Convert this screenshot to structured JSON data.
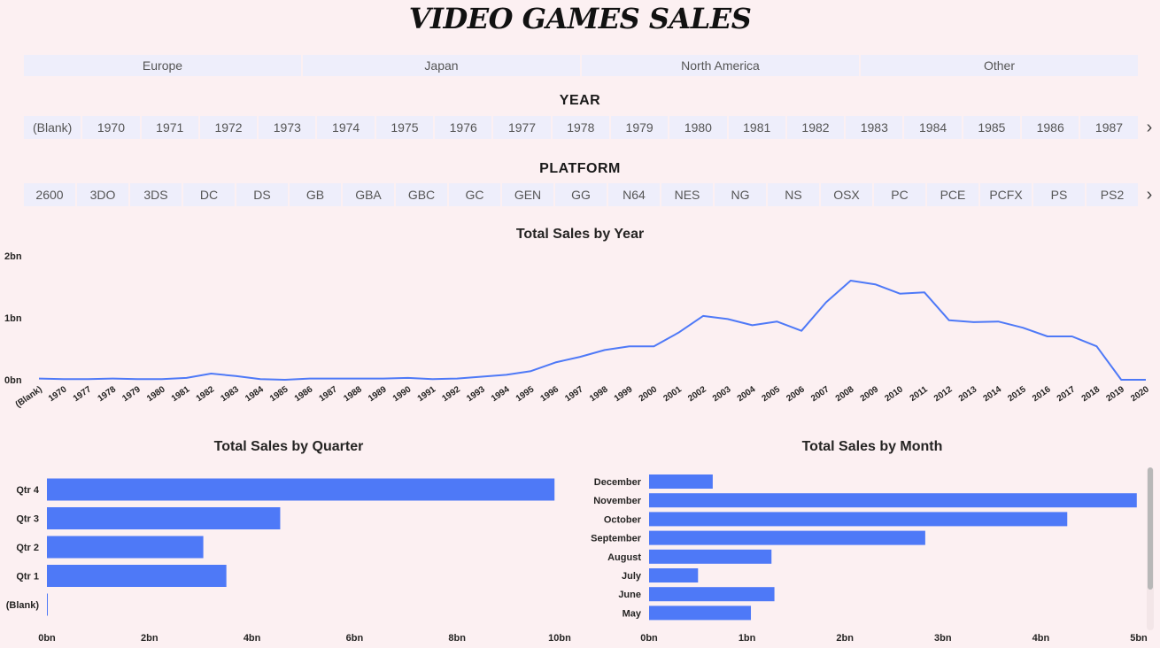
{
  "title": "VIDEO GAMES SALES",
  "region_slicer": [
    "Europe",
    "Japan",
    "North America",
    "Other"
  ],
  "year_slicer": {
    "label": "YEAR",
    "items": [
      "(Blank)",
      "1970",
      "1971",
      "1972",
      "1973",
      "1974",
      "1975",
      "1976",
      "1977",
      "1978",
      "1979",
      "1980",
      "1981",
      "1982",
      "1983",
      "1984",
      "1985",
      "1986",
      "1987"
    ]
  },
  "platform_slicer": {
    "label": "PLATFORM",
    "items": [
      "2600",
      "3DO",
      "3DS",
      "DC",
      "DS",
      "GB",
      "GBA",
      "GBC",
      "GC",
      "GEN",
      "GG",
      "N64",
      "NES",
      "NG",
      "NS",
      "OSX",
      "PC",
      "PCE",
      "PCFX",
      "PS",
      "PS2"
    ]
  },
  "icons": {
    "next": "chevron-right-icon"
  },
  "colors": {
    "bar": "#4e79f7",
    "line": "#4e79f7",
    "background": "#fcf0f2",
    "chip": "#eeeefb"
  },
  "chart_data": [
    {
      "type": "line",
      "title": "Total Sales by Year",
      "x": [
        "(Blank)",
        "1970",
        "1977",
        "1978",
        "1979",
        "1980",
        "1981",
        "1982",
        "1983",
        "1984",
        "1985",
        "1986",
        "1987",
        "1988",
        "1989",
        "1990",
        "1991",
        "1992",
        "1993",
        "1994",
        "1995",
        "1996",
        "1997",
        "1998",
        "1999",
        "2000",
        "2001",
        "2002",
        "2003",
        "2004",
        "2005",
        "2006",
        "2007",
        "2008",
        "2009",
        "2010",
        "2011",
        "2012",
        "2013",
        "2014",
        "2015",
        "2016",
        "2017",
        "2018",
        "2019",
        "2020"
      ],
      "values": [
        0.02,
        0.01,
        0.01,
        0.02,
        0.01,
        0.01,
        0.03,
        0.1,
        0.06,
        0.01,
        0.0,
        0.02,
        0.02,
        0.02,
        0.02,
        0.03,
        0.01,
        0.02,
        0.05,
        0.08,
        0.14,
        0.28,
        0.37,
        0.48,
        0.54,
        0.54,
        0.76,
        1.03,
        0.98,
        0.88,
        0.94,
        0.79,
        1.25,
        1.6,
        1.54,
        1.39,
        1.41,
        0.96,
        0.93,
        0.94,
        0.84,
        0.7,
        0.7,
        0.54,
        0.0,
        0.0
      ],
      "y_ticks": [
        "0bn",
        "1bn",
        "2bn"
      ],
      "ylim": [
        0,
        2
      ]
    },
    {
      "type": "bar",
      "title": "Total Sales by Quarter",
      "categories": [
        "Qtr 4",
        "Qtr 3",
        "Qtr 2",
        "Qtr 1",
        "(Blank)"
      ],
      "values": [
        9.9,
        4.55,
        3.05,
        3.5,
        0.01
      ],
      "x_ticks": [
        "0bn",
        "2bn",
        "4bn",
        "6bn",
        "8bn",
        "10bn"
      ],
      "xlim": [
        0,
        10
      ]
    },
    {
      "type": "bar",
      "title": "Total Sales by Month",
      "categories": [
        "December",
        "November",
        "October",
        "September",
        "August",
        "July",
        "June",
        "May"
      ],
      "values": [
        0.65,
        4.98,
        4.27,
        2.82,
        1.25,
        0.5,
        1.28,
        1.04
      ],
      "x_ticks": [
        "0bn",
        "1bn",
        "2bn",
        "3bn",
        "4bn",
        "5bn"
      ],
      "xlim": [
        0,
        5
      ]
    }
  ]
}
